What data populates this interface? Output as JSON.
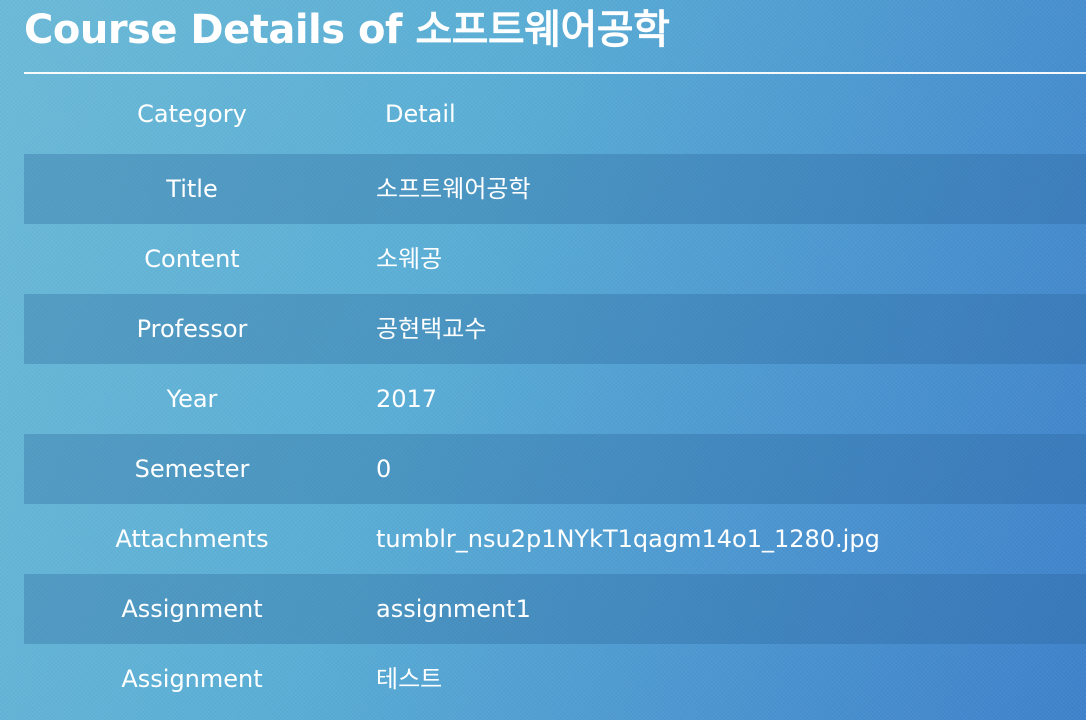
{
  "page": {
    "title": "Course Details of 소프트웨어공학"
  },
  "table": {
    "headers": {
      "category": "Category",
      "detail": "Detail"
    },
    "rows": [
      {
        "category": "Title",
        "detail": "소프트웨어공학"
      },
      {
        "category": "Content",
        "detail": "소웨공"
      },
      {
        "category": "Professor",
        "detail": "공현택교수"
      },
      {
        "category": "Year",
        "detail": "2017"
      },
      {
        "category": "Semester",
        "detail": "0"
      },
      {
        "category": "Attachments",
        "detail": "tumblr_nsu2p1NYkT1qagm14o1_1280.jpg"
      },
      {
        "category": "Assignment",
        "detail": "assignment1"
      },
      {
        "category": "Assignment",
        "detail": "테스트"
      }
    ]
  },
  "colors": {
    "background_left": "#6cbad8",
    "background_right": "#3f82cb",
    "text": "#ffffff",
    "stripe": "rgba(40,95,150,0.30)"
  }
}
